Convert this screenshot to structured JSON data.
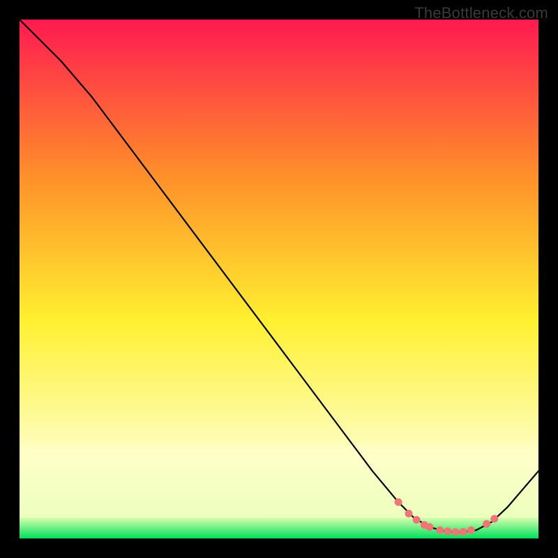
{
  "watermark": "TheBottleneck.com",
  "colors": {
    "frame": "#000000",
    "gradient_top": "#ff1a51",
    "gradient_upper_mid": "#ff8f2a",
    "gradient_mid": "#fff030",
    "gradient_lower_mid": "#f9ffb3",
    "gradient_bottom": "#00e05a",
    "line": "#000000",
    "marker": "#f07575",
    "pale_band": "#fdffc9"
  },
  "chart_data": {
    "type": "line",
    "title": "",
    "xlabel": "",
    "ylabel": "",
    "xlim": [
      0,
      100
    ],
    "ylim": [
      0,
      100
    ],
    "grid": false,
    "legend": false,
    "series": [
      {
        "name": "bottleneck-curve",
        "x": [
          0,
          3,
          8,
          14,
          20,
          26,
          32,
          38,
          44,
          50,
          56,
          62,
          68,
          73,
          76,
          79,
          82,
          85,
          88,
          91,
          94,
          97,
          100
        ],
        "y": [
          100,
          97,
          92,
          85,
          77,
          69,
          61,
          53,
          45,
          37,
          29,
          21,
          13,
          7,
          4,
          2.2,
          1.4,
          1.2,
          1.6,
          3.2,
          6.0,
          9.5,
          13
        ]
      }
    ],
    "markers": {
      "series": "bottleneck-curve",
      "points": [
        {
          "x": 73,
          "y": 7
        },
        {
          "x": 75,
          "y": 4.8
        },
        {
          "x": 76.5,
          "y": 3.6
        },
        {
          "x": 78,
          "y": 2.6
        },
        {
          "x": 79,
          "y": 2.2
        },
        {
          "x": 81,
          "y": 1.6
        },
        {
          "x": 82.5,
          "y": 1.4
        },
        {
          "x": 84,
          "y": 1.25
        },
        {
          "x": 85.5,
          "y": 1.3
        },
        {
          "x": 87,
          "y": 1.6
        },
        {
          "x": 90,
          "y": 2.8
        },
        {
          "x": 91.5,
          "y": 3.8
        }
      ]
    }
  }
}
